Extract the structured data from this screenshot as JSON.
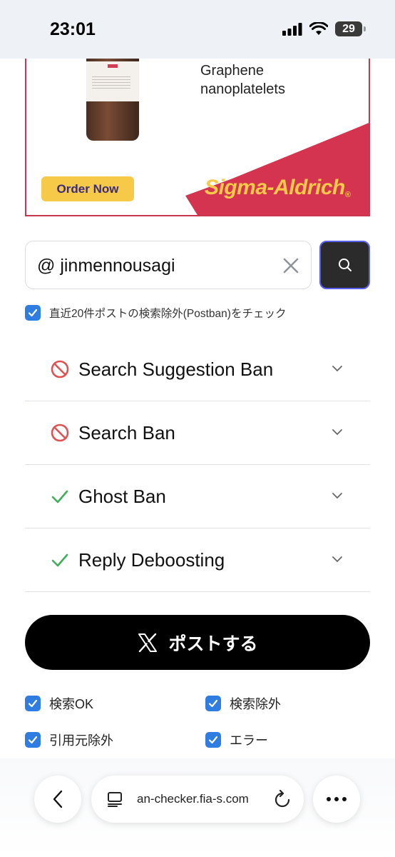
{
  "status_bar": {
    "time": "23:01",
    "battery": "29"
  },
  "ad": {
    "product_title_line1": "Graphene",
    "product_title_line2": "nanoplatelets",
    "order_button": "Order Now",
    "brand": "Sigma-Aldrich",
    "brand_mark": "®",
    "colors": {
      "brand_red": "#d4344f",
      "brand_yellow": "#f7c948"
    }
  },
  "search": {
    "value": "@ jinmennousagi",
    "clear_icon": "close-icon",
    "search_icon": "search-icon"
  },
  "postban_option": {
    "label": "直近20件ポストの検索除外(Postban)をチェック",
    "checked": true
  },
  "ban_results": [
    {
      "label": "Search Suggestion Ban",
      "status": "banned",
      "icon": "prohibited-icon"
    },
    {
      "label": "Search Ban",
      "status": "banned",
      "icon": "prohibited-icon"
    },
    {
      "label": "Ghost Ban",
      "status": "ok",
      "icon": "check-icon"
    },
    {
      "label": "Reply Deboosting",
      "status": "ok",
      "icon": "check-icon"
    }
  ],
  "post_button": {
    "label": "ポストする",
    "icon": "x-logo-icon"
  },
  "legend": [
    {
      "label": "検索OK",
      "checked": true
    },
    {
      "label": "検索除外",
      "checked": true
    },
    {
      "label": "引用元除外",
      "checked": true
    },
    {
      "label": "エラー",
      "checked": true
    }
  ],
  "browser": {
    "url": "an-checker.fia-s.com"
  },
  "colors": {
    "accent_blue": "#2f7de1",
    "ban_red": "#e05252",
    "ok_green": "#3fae5a"
  }
}
